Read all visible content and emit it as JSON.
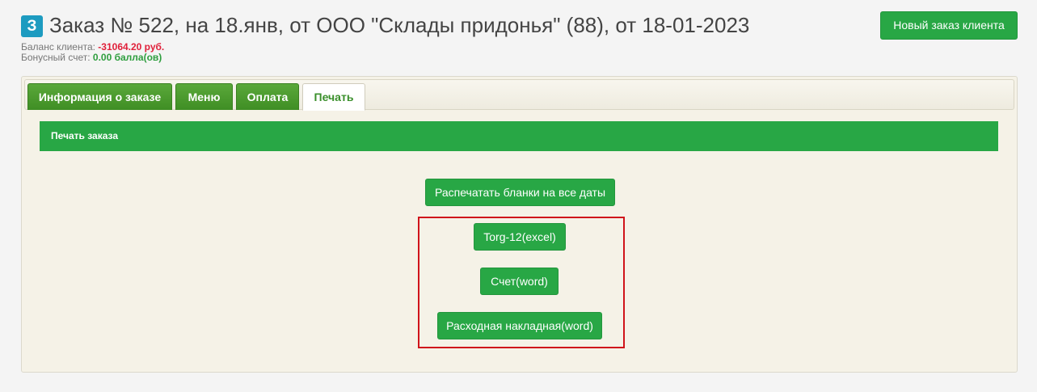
{
  "header": {
    "badge": "З",
    "title": "Заказ № 522, на 18.янв, от ООО \"Склады придонья\" (88), от 18-01-2023",
    "balance_label": "Баланс клиента:",
    "balance_value": "-31064.20 руб.",
    "bonus_label": "Бонусный счет:",
    "bonus_value": "0.00 балла(ов)",
    "new_order_button": "Новый заказ клиента"
  },
  "tabs": [
    {
      "label": "Информация о заказе",
      "active": false
    },
    {
      "label": "Меню",
      "active": false
    },
    {
      "label": "Оплата",
      "active": false
    },
    {
      "label": "Печать",
      "active": true
    }
  ],
  "print_section": {
    "title": "Печать заказа",
    "print_all_button": "Распечатать бланки на все даты",
    "torg12_button": "Torg-12(excel)",
    "invoice_button": "Счет(word)",
    "waybill_button": "Расходная накладная(word)"
  },
  "colors": {
    "primary_green": "#28a745",
    "tab_green": "#4a9a2e",
    "badge_blue": "#1d9bc0",
    "negative_red": "#e0203a",
    "highlight_red": "#d0141b"
  }
}
